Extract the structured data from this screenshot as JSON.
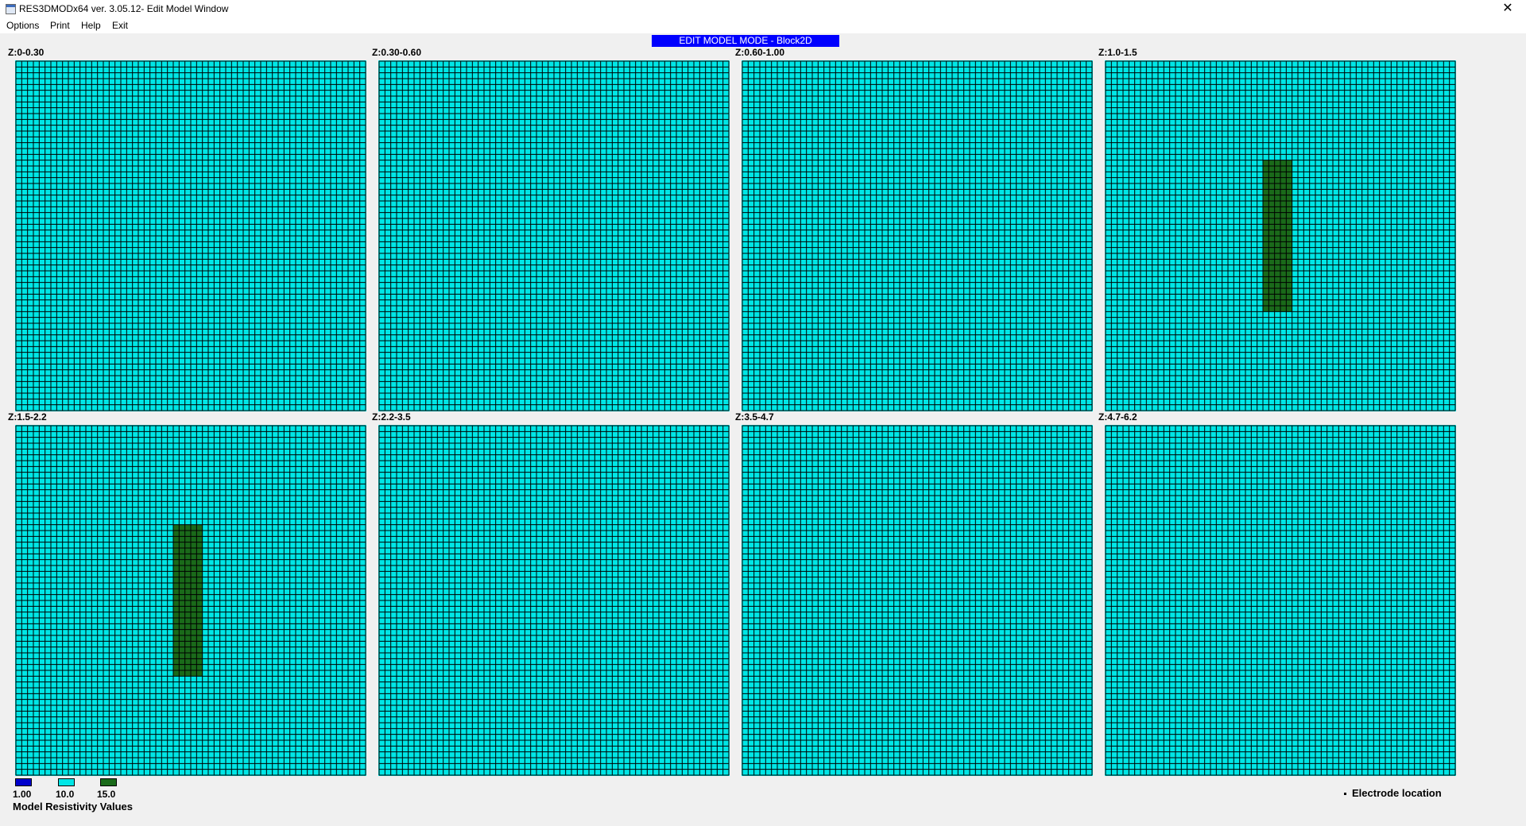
{
  "window": {
    "title": "RES3DMODx64 ver. 3.05.12- Edit Model Window",
    "close_glyph": "✕"
  },
  "menu": {
    "items": [
      {
        "label": "Options"
      },
      {
        "label": "Print"
      },
      {
        "label": "Help"
      },
      {
        "label": "Exit"
      }
    ]
  },
  "mode_banner": "EDIT MODEL MODE  -  Block2D",
  "grid": {
    "columns": 60,
    "rows": 60,
    "background_color": "#00e6e6",
    "line_color": "#000000"
  },
  "panels": [
    {
      "label": "Z:0-0.30",
      "blocks": []
    },
    {
      "label": "Z:0.30-0.60",
      "blocks": []
    },
    {
      "label": "Z:0.60-1.00",
      "blocks": []
    },
    {
      "label": "Z:1.0-1.5",
      "blocks": [
        {
          "col_start": 27,
          "col_end": 32,
          "row_start": 17,
          "row_end": 43,
          "value": "15.0"
        }
      ]
    },
    {
      "label": "Z:1.5-2.2",
      "blocks": [
        {
          "col_start": 27,
          "col_end": 32,
          "row_start": 17,
          "row_end": 43,
          "value": "15.0"
        }
      ]
    },
    {
      "label": "Z:2.2-3.5",
      "blocks": []
    },
    {
      "label": "Z:3.5-4.7",
      "blocks": []
    },
    {
      "label": "Z:4.7-6.2",
      "blocks": []
    }
  ],
  "legend": {
    "title": "Model Resistivity Values",
    "items": [
      {
        "value": "1.00",
        "color": "#0000cc"
      },
      {
        "value": "10.0",
        "color": "#00e6e6"
      },
      {
        "value": "15.0",
        "color": "#1a6a1a"
      }
    ]
  },
  "electrode_legend": {
    "label": "Electrode location"
  }
}
